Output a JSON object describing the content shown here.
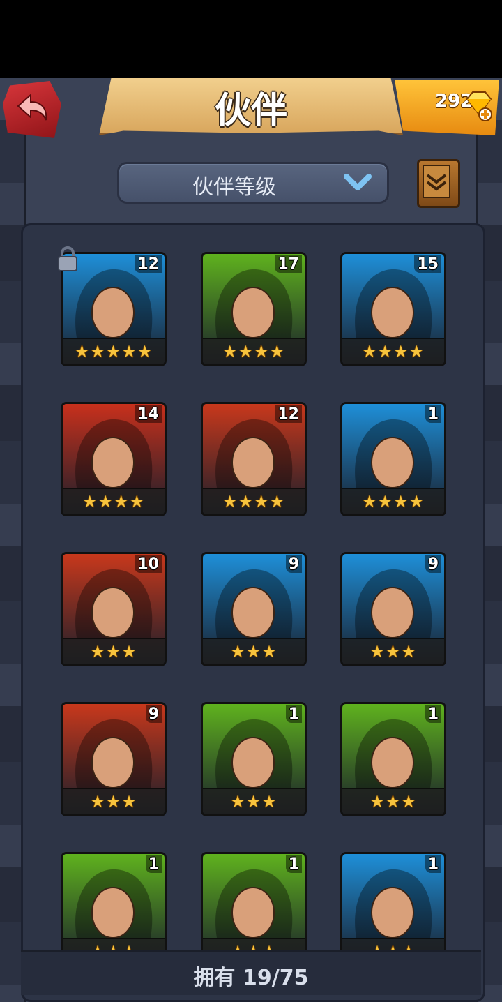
{
  "header": {
    "title": "伙伴",
    "gems": "292",
    "back_icon": "back-arrow-icon",
    "gem_icon": "diamond-plus-icon"
  },
  "sort": {
    "label": "伙伴等级",
    "chevron_icon": "chevron-down-icon"
  },
  "scroll_button": {
    "icon": "scroll-icon"
  },
  "companions": [
    {
      "level": "12",
      "stars": "★★★★★",
      "color": "#1e8fd8",
      "locked": true
    },
    {
      "level": "17",
      "stars": "★★★★",
      "color": "#5fb21e",
      "locked": false
    },
    {
      "level": "15",
      "stars": "★★★★",
      "color": "#1e8fd8",
      "locked": false
    },
    {
      "level": "14",
      "stars": "★★★★",
      "color": "#c8301c",
      "locked": false
    },
    {
      "level": "12",
      "stars": "★★★★",
      "color": "#c8381c",
      "locked": false
    },
    {
      "level": "1",
      "stars": "★★★★",
      "color": "#1e8fd8",
      "locked": false
    },
    {
      "level": "10",
      "stars": "★★★",
      "color": "#c8381c",
      "locked": false
    },
    {
      "level": "9",
      "stars": "★★★",
      "color": "#1e8fd8",
      "locked": false
    },
    {
      "level": "9",
      "stars": "★★★",
      "color": "#1e8fd8",
      "locked": false
    },
    {
      "level": "9",
      "stars": "★★★",
      "color": "#c8381c",
      "locked": false
    },
    {
      "level": "1",
      "stars": "★★★",
      "color": "#5fb21e",
      "locked": false
    },
    {
      "level": "1",
      "stars": "★★★",
      "color": "#5fb21e",
      "locked": false
    },
    {
      "level": "1",
      "stars": "★★★",
      "color": "#5fb21e",
      "locked": false
    },
    {
      "level": "1",
      "stars": "★★★",
      "color": "#5fb21e",
      "locked": false
    },
    {
      "level": "1",
      "stars": "★★★",
      "color": "#1e8fd8",
      "locked": false
    }
  ],
  "footer": {
    "owned": "拥有 19/75"
  }
}
